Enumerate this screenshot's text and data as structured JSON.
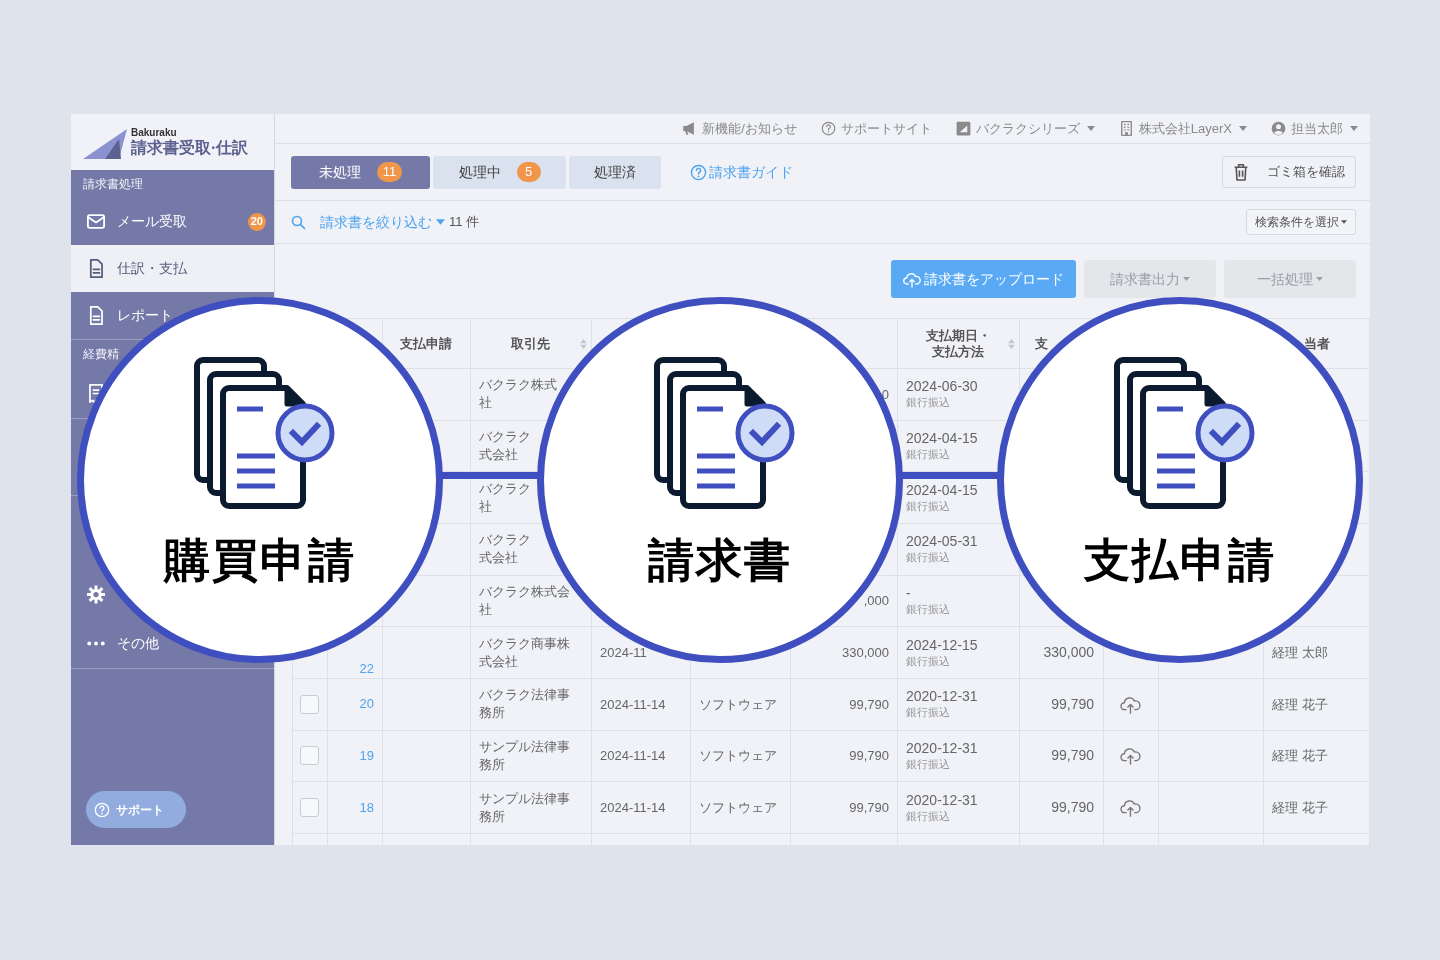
{
  "sidebar": {
    "brand": "Bakuraku",
    "product": "請求書受取·仕訳",
    "groups": [
      {
        "title": "請求書処理",
        "items": [
          {
            "label": "メール受取",
            "kind": "mail",
            "badge": "20",
            "selected": false
          },
          {
            "label": "仕訳・支払",
            "kind": "document",
            "selected": true
          },
          {
            "label": "レポート",
            "kind": "document",
            "selected": false
          }
        ]
      },
      {
        "title": "経費精",
        "items": [
          {
            "kind": "receipt",
            "selected": false
          }
        ]
      },
      {
        "items": [
          {
            "kind": "gear",
            "selected": false
          },
          {
            "label": "その他",
            "kind": "dots",
            "selected": false
          }
        ]
      }
    ],
    "support": "サポート"
  },
  "top_bar": [
    {
      "label": "新機能/お知らせ",
      "dropdown": false
    },
    {
      "label": "サポートサイト",
      "dropdown": false
    },
    {
      "label": "バクラクシリーズ",
      "dropdown": true
    },
    {
      "label": "株式会社LayerX",
      "dropdown": true
    },
    {
      "label": "担当太郎",
      "dropdown": true
    }
  ],
  "tabs": [
    {
      "label": "未処理",
      "count": "11",
      "selected": true
    },
    {
      "label": "処理中",
      "count": "5",
      "selected": false
    },
    {
      "label": "処理済",
      "selected": false
    }
  ],
  "guide_link": "請求書ガイド",
  "trash_button": "ゴミ箱を確認",
  "filter": {
    "label": "請求書を絞り込む",
    "count": "11 件",
    "search_conditions": "検索条件を選択"
  },
  "actions": [
    {
      "label": "請求書をアップロード",
      "kind": "primary",
      "dropdown": false,
      "disabled": false
    },
    {
      "label": "請求書出力",
      "kind": "secondary",
      "dropdown": true,
      "disabled": true
    },
    {
      "label": "一括処理",
      "kind": "secondary",
      "dropdown": true,
      "disabled": true
    }
  ],
  "table": {
    "columns": [
      {
        "label": [
          "支払申請"
        ],
        "sortable": false
      },
      {
        "label": [
          "取引先"
        ],
        "sortable": true
      },
      {
        "label": [
          "支払期日・",
          "支払方法"
        ],
        "sortable": true
      },
      {
        "label": [
          "支"
        ],
        "sortable": false
      },
      {
        "label": [
          "当者"
        ],
        "sortable": false
      }
    ],
    "rows": [
      {
        "vendor": [
          "バクラク株式",
          "社"
        ],
        "amount": "0",
        "due_date": "2024-06-30",
        "payment_method": "銀行振込"
      },
      {
        "vendor": [
          "バクラク",
          "式会社"
        ],
        "due_date": "2024-04-15",
        "payment_method": "銀行振込"
      },
      {
        "vendor": [
          "バクラク",
          "社"
        ],
        "due_date": "2024-04-15",
        "payment_method": "銀行振込"
      },
      {
        "vendor": [
          "バクラク",
          "式会社"
        ],
        "due_date": "2024-05-31",
        "payment_method": "銀行振込"
      },
      {
        "vendor": [
          "バクラク株式会",
          "社"
        ],
        "amount": ",000",
        "due_date": "-",
        "payment_method": "銀行振込"
      },
      {
        "id": "22",
        "vendor": [
          "バクラク商事株",
          "式会社"
        ],
        "date": "2024-11",
        "amount": "330,000",
        "due_date": "2024-12-15",
        "payment_method": "銀行振込",
        "payment_amount": "330,000",
        "manager": "経理 太郎"
      },
      {
        "checkbox": {
          "checked": false
        },
        "id": "20",
        "vendor": [
          "バクラク法律事",
          "務所"
        ],
        "date": "2024-11-14",
        "type": "ソフトウェア",
        "amount": "99,790",
        "due_date": "2020-12-31",
        "payment_method": "銀行振込",
        "payment_amount": "99,790",
        "upload": true,
        "manager": "経理 花子"
      },
      {
        "checkbox": {
          "checked": false
        },
        "id": "19",
        "vendor": [
          "サンプル法律事",
          "務所"
        ],
        "date": "2024-11-14",
        "type": "ソフトウェア",
        "amount": "99,790",
        "due_date": "2020-12-31",
        "payment_method": "銀行振込",
        "payment_amount": "99,790",
        "upload": true,
        "manager": "経理 花子"
      },
      {
        "checkbox": {
          "checked": false
        },
        "id": "18",
        "vendor": [
          "サンプル法律事",
          "務所"
        ],
        "date": "2024-11-14",
        "type": "ソフトウェア",
        "amount": "99,790",
        "due_date": "2020-12-31",
        "payment_method": "銀行振込",
        "payment_amount": "99,790",
        "upload": true,
        "manager": "経理 花子"
      }
    ]
  },
  "feature_circles": [
    {
      "label": "購買申請"
    },
    {
      "label": "請求書"
    },
    {
      "label": "支払申請"
    }
  ]
}
